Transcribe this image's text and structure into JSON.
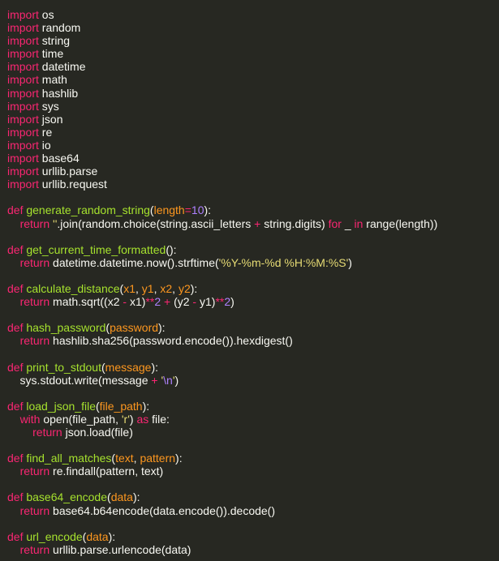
{
  "editor": {
    "colors": {
      "background": "#272822",
      "plain": "#f8f8f2",
      "keyword": "#f92672",
      "function_name": "#a6e22e",
      "parameter": "#fd971f",
      "number": "#ae81ff",
      "string": "#e6db74"
    },
    "lines": [
      [
        {
          "t": "import",
          "c": "keyword"
        },
        {
          "t": " os",
          "c": "plain"
        }
      ],
      [
        {
          "t": "import",
          "c": "keyword"
        },
        {
          "t": " random",
          "c": "plain"
        }
      ],
      [
        {
          "t": "import",
          "c": "keyword"
        },
        {
          "t": " string",
          "c": "plain"
        }
      ],
      [
        {
          "t": "import",
          "c": "keyword"
        },
        {
          "t": " time",
          "c": "plain"
        }
      ],
      [
        {
          "t": "import",
          "c": "keyword"
        },
        {
          "t": " datetime",
          "c": "plain"
        }
      ],
      [
        {
          "t": "import",
          "c": "keyword"
        },
        {
          "t": " math",
          "c": "plain"
        }
      ],
      [
        {
          "t": "import",
          "c": "keyword"
        },
        {
          "t": " hashlib",
          "c": "plain"
        }
      ],
      [
        {
          "t": "import",
          "c": "keyword"
        },
        {
          "t": " sys",
          "c": "plain"
        }
      ],
      [
        {
          "t": "import",
          "c": "keyword"
        },
        {
          "t": " json",
          "c": "plain"
        }
      ],
      [
        {
          "t": "import",
          "c": "keyword"
        },
        {
          "t": " re",
          "c": "plain"
        }
      ],
      [
        {
          "t": "import",
          "c": "keyword"
        },
        {
          "t": " io",
          "c": "plain"
        }
      ],
      [
        {
          "t": "import",
          "c": "keyword"
        },
        {
          "t": " base64",
          "c": "plain"
        }
      ],
      [
        {
          "t": "import",
          "c": "keyword"
        },
        {
          "t": " urllib.parse",
          "c": "plain"
        }
      ],
      [
        {
          "t": "import",
          "c": "keyword"
        },
        {
          "t": " urllib.request",
          "c": "plain"
        }
      ],
      [],
      [
        {
          "t": "def",
          "c": "keyword"
        },
        {
          "t": " ",
          "c": "plain"
        },
        {
          "t": "generate_random_string",
          "c": "func"
        },
        {
          "t": "(",
          "c": "plain"
        },
        {
          "t": "length",
          "c": "param"
        },
        {
          "t": "=",
          "c": "keyword"
        },
        {
          "t": "10",
          "c": "number"
        },
        {
          "t": "):",
          "c": "plain"
        }
      ],
      [
        {
          "t": "    ",
          "c": "plain"
        },
        {
          "t": "return",
          "c": "keyword"
        },
        {
          "t": " ",
          "c": "plain"
        },
        {
          "t": "''",
          "c": "string"
        },
        {
          "t": ".join(random.choice(string.ascii_letters ",
          "c": "plain"
        },
        {
          "t": "+",
          "c": "keyword"
        },
        {
          "t": " string.digits) ",
          "c": "plain"
        },
        {
          "t": "for",
          "c": "keyword"
        },
        {
          "t": " _ ",
          "c": "plain"
        },
        {
          "t": "in",
          "c": "keyword"
        },
        {
          "t": " range(length))",
          "c": "plain"
        }
      ],
      [],
      [
        {
          "t": "def",
          "c": "keyword"
        },
        {
          "t": " ",
          "c": "plain"
        },
        {
          "t": "get_current_time_formatted",
          "c": "func"
        },
        {
          "t": "():",
          "c": "plain"
        }
      ],
      [
        {
          "t": "    ",
          "c": "plain"
        },
        {
          "t": "return",
          "c": "keyword"
        },
        {
          "t": " datetime.datetime.now().strftime(",
          "c": "plain"
        },
        {
          "t": "'%Y-%m-%d %H:%M:%S'",
          "c": "string"
        },
        {
          "t": ")",
          "c": "plain"
        }
      ],
      [],
      [
        {
          "t": "def",
          "c": "keyword"
        },
        {
          "t": " ",
          "c": "plain"
        },
        {
          "t": "calculate_distance",
          "c": "func"
        },
        {
          "t": "(",
          "c": "plain"
        },
        {
          "t": "x1",
          "c": "param"
        },
        {
          "t": ", ",
          "c": "plain"
        },
        {
          "t": "y1",
          "c": "param"
        },
        {
          "t": ", ",
          "c": "plain"
        },
        {
          "t": "x2",
          "c": "param"
        },
        {
          "t": ", ",
          "c": "plain"
        },
        {
          "t": "y2",
          "c": "param"
        },
        {
          "t": "):",
          "c": "plain"
        }
      ],
      [
        {
          "t": "    ",
          "c": "plain"
        },
        {
          "t": "return",
          "c": "keyword"
        },
        {
          "t": " math.sqrt((x2 ",
          "c": "plain"
        },
        {
          "t": "-",
          "c": "keyword"
        },
        {
          "t": " x1)",
          "c": "plain"
        },
        {
          "t": "**",
          "c": "keyword"
        },
        {
          "t": "2",
          "c": "number"
        },
        {
          "t": " ",
          "c": "plain"
        },
        {
          "t": "+",
          "c": "keyword"
        },
        {
          "t": " (y2 ",
          "c": "plain"
        },
        {
          "t": "-",
          "c": "keyword"
        },
        {
          "t": " y1)",
          "c": "plain"
        },
        {
          "t": "**",
          "c": "keyword"
        },
        {
          "t": "2",
          "c": "number"
        },
        {
          "t": ")",
          "c": "plain"
        }
      ],
      [],
      [
        {
          "t": "def",
          "c": "keyword"
        },
        {
          "t": " ",
          "c": "plain"
        },
        {
          "t": "hash_password",
          "c": "func"
        },
        {
          "t": "(",
          "c": "plain"
        },
        {
          "t": "password",
          "c": "param"
        },
        {
          "t": "):",
          "c": "plain"
        }
      ],
      [
        {
          "t": "    ",
          "c": "plain"
        },
        {
          "t": "return",
          "c": "keyword"
        },
        {
          "t": " hashlib.sha256(password.encode()).hexdigest()",
          "c": "plain"
        }
      ],
      [],
      [
        {
          "t": "def",
          "c": "keyword"
        },
        {
          "t": " ",
          "c": "plain"
        },
        {
          "t": "print_to_stdout",
          "c": "func"
        },
        {
          "t": "(",
          "c": "plain"
        },
        {
          "t": "message",
          "c": "param"
        },
        {
          "t": "):",
          "c": "plain"
        }
      ],
      [
        {
          "t": "    sys.stdout.write(message ",
          "c": "plain"
        },
        {
          "t": "+",
          "c": "keyword"
        },
        {
          "t": " ",
          "c": "plain"
        },
        {
          "t": "'",
          "c": "string"
        },
        {
          "t": "\\n",
          "c": "number"
        },
        {
          "t": "'",
          "c": "string"
        },
        {
          "t": ")",
          "c": "plain"
        }
      ],
      [],
      [
        {
          "t": "def",
          "c": "keyword"
        },
        {
          "t": " ",
          "c": "plain"
        },
        {
          "t": "load_json_file",
          "c": "func"
        },
        {
          "t": "(",
          "c": "plain"
        },
        {
          "t": "file_path",
          "c": "param"
        },
        {
          "t": "):",
          "c": "plain"
        }
      ],
      [
        {
          "t": "    ",
          "c": "plain"
        },
        {
          "t": "with",
          "c": "keyword"
        },
        {
          "t": " open(file_path, ",
          "c": "plain"
        },
        {
          "t": "'r'",
          "c": "string"
        },
        {
          "t": ") ",
          "c": "plain"
        },
        {
          "t": "as",
          "c": "keyword"
        },
        {
          "t": " file:",
          "c": "plain"
        }
      ],
      [
        {
          "t": "        ",
          "c": "plain"
        },
        {
          "t": "return",
          "c": "keyword"
        },
        {
          "t": " json.load(file)",
          "c": "plain"
        }
      ],
      [],
      [
        {
          "t": "def",
          "c": "keyword"
        },
        {
          "t": " ",
          "c": "plain"
        },
        {
          "t": "find_all_matches",
          "c": "func"
        },
        {
          "t": "(",
          "c": "plain"
        },
        {
          "t": "text",
          "c": "param"
        },
        {
          "t": ", ",
          "c": "plain"
        },
        {
          "t": "pattern",
          "c": "param"
        },
        {
          "t": "):",
          "c": "plain"
        }
      ],
      [
        {
          "t": "    ",
          "c": "plain"
        },
        {
          "t": "return",
          "c": "keyword"
        },
        {
          "t": " re.findall(pattern, text)",
          "c": "plain"
        }
      ],
      [],
      [
        {
          "t": "def",
          "c": "keyword"
        },
        {
          "t": " ",
          "c": "plain"
        },
        {
          "t": "base64_encode",
          "c": "func"
        },
        {
          "t": "(",
          "c": "plain"
        },
        {
          "t": "data",
          "c": "param"
        },
        {
          "t": "):",
          "c": "plain"
        }
      ],
      [
        {
          "t": "    ",
          "c": "plain"
        },
        {
          "t": "return",
          "c": "keyword"
        },
        {
          "t": " base64.b64encode(data.encode()).decode()",
          "c": "plain"
        }
      ],
      [],
      [
        {
          "t": "def",
          "c": "keyword"
        },
        {
          "t": " ",
          "c": "plain"
        },
        {
          "t": "url_encode",
          "c": "func"
        },
        {
          "t": "(",
          "c": "plain"
        },
        {
          "t": "data",
          "c": "param"
        },
        {
          "t": "):",
          "c": "plain"
        }
      ],
      [
        {
          "t": "    ",
          "c": "plain"
        },
        {
          "t": "return",
          "c": "keyword"
        },
        {
          "t": " urllib.parse.urlencode(data)",
          "c": "plain"
        }
      ]
    ]
  }
}
